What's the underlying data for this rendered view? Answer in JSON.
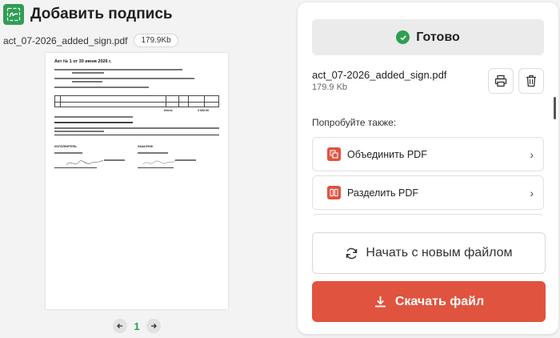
{
  "header": {
    "title": "Добавить подпись",
    "logo_icon": "signature-icon"
  },
  "file": {
    "name": "act_07-2026_added_sign.pdf",
    "size_badge": "179.9Kb"
  },
  "document": {
    "heading": "Акт № 1 от 30 июня 2026 г.",
    "total_label": "Итого:",
    "total_value": "3 600.00",
    "left_party": "ИСПОЛНИТЕЛЬ",
    "right_party": "ЗАКАЗЧИК"
  },
  "pager": {
    "page": "1",
    "prev_icon": "arrow-left-icon",
    "next_icon": "arrow-right-icon"
  },
  "panel": {
    "status": "Готово",
    "result_name": "act_07-2026_added_sign.pdf",
    "result_size": "179.9 Kb",
    "suggest_title": "Попробуйте также:",
    "suggestions": [
      {
        "label": "Объединить PDF",
        "icon": "merge-pdf-icon"
      },
      {
        "label": "Разделить PDF",
        "icon": "split-pdf-icon"
      }
    ],
    "new_file_label": "Начать с новым файлом",
    "download_label": "Скачать файл"
  },
  "colors": {
    "accent_green": "#2f9e54",
    "accent_red": "#e0533f"
  }
}
